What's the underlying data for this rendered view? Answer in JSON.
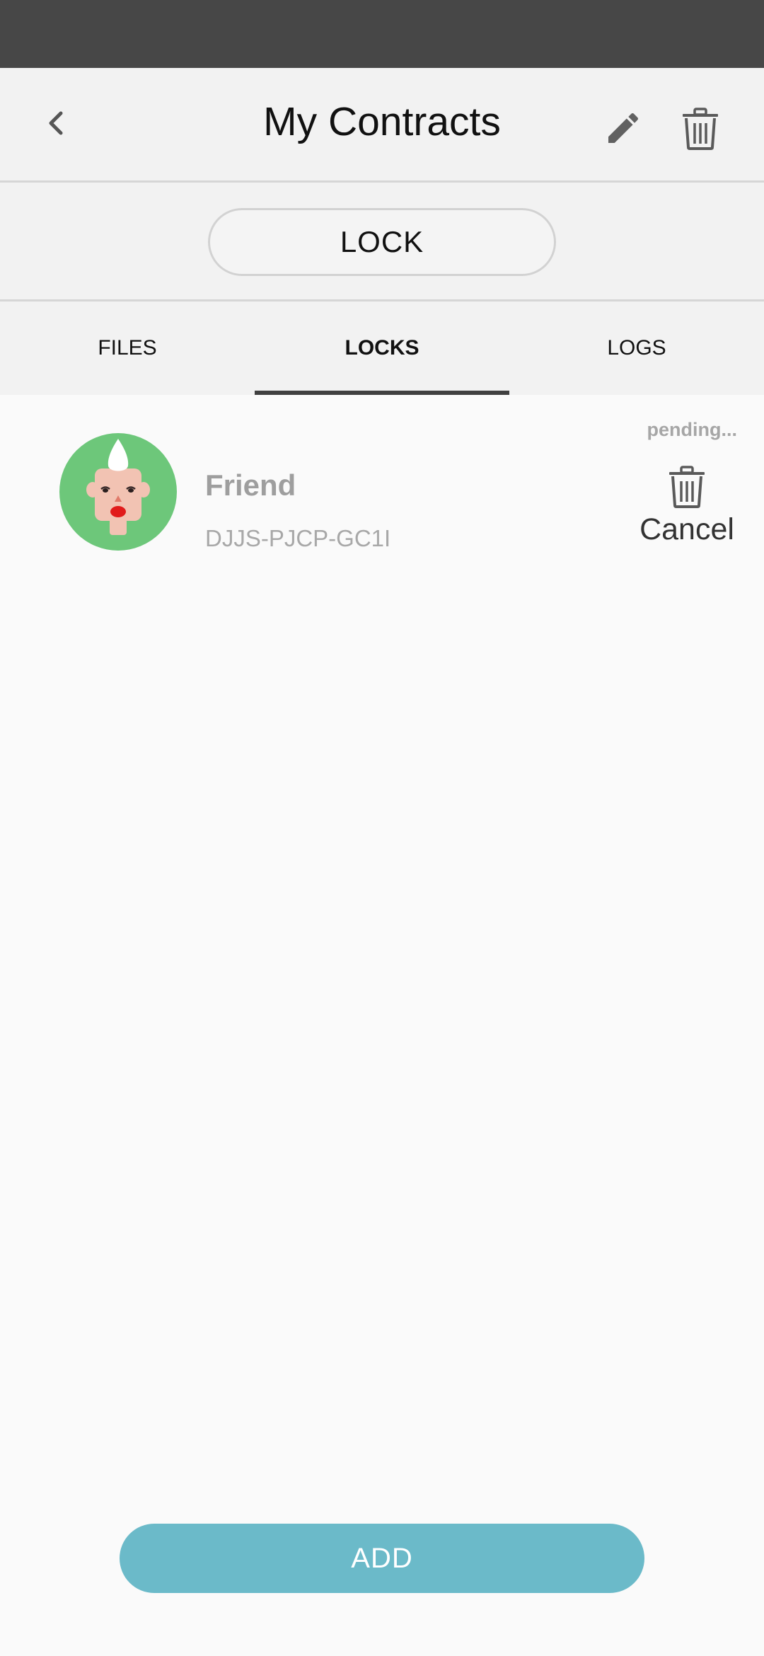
{
  "header": {
    "title": "My Contracts",
    "back_icon": "chevron-left-icon",
    "edit_icon": "pencil-icon",
    "delete_icon": "trash-icon"
  },
  "lock_button": {
    "label": "LOCK"
  },
  "tabs": [
    {
      "label": "FILES",
      "active": false
    },
    {
      "label": "LOCKS",
      "active": true
    },
    {
      "label": "LOGS",
      "active": false
    }
  ],
  "locks": [
    {
      "name": "Friend",
      "code": "DJJS-PJCP-GC1I",
      "status": "pending...",
      "cancel_label": "Cancel",
      "avatar_color": "#6dc77a"
    }
  ],
  "add_button": {
    "label": "ADD",
    "color": "#6bbac9"
  },
  "colors": {
    "status_bar": "#474747",
    "header_bg": "#f2f2f2",
    "page_bg": "#fafafa",
    "accent": "#6bbac9"
  }
}
